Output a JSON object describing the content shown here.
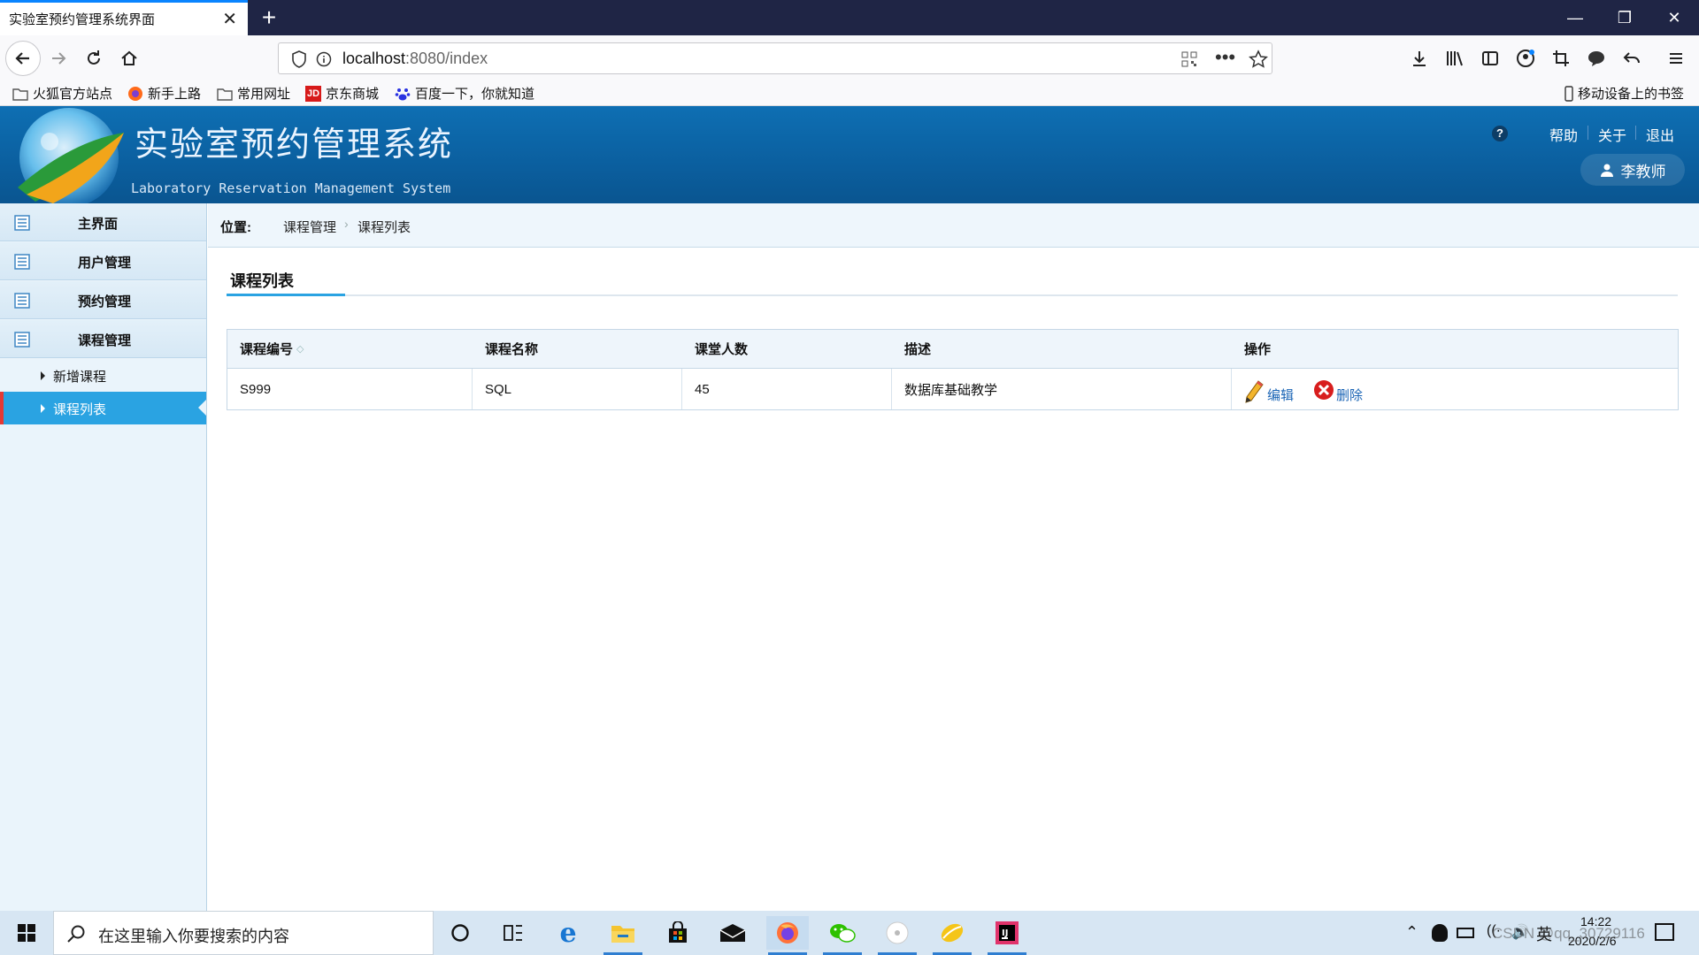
{
  "browser": {
    "tab_title": "实验室预约管理系统界面",
    "url_host": "localhost",
    "url_rest": ":8080/index",
    "bookmarks": [
      "火狐官方站点",
      "新手上路",
      "常用网址",
      "京东商城",
      "百度一下，你就知道"
    ],
    "mobile_bookmarks": "移动设备上的书签"
  },
  "header": {
    "title": "实验室预约管理系统",
    "subtitle": "Laboratory Reservation Management System",
    "help": "帮助",
    "about": "关于",
    "logout": "退出",
    "user": "李教师"
  },
  "sidebar": {
    "items": [
      {
        "label": "主界面"
      },
      {
        "label": "用户管理"
      },
      {
        "label": "预约管理"
      },
      {
        "label": "课程管理"
      }
    ],
    "subitems": [
      {
        "label": "新增课程"
      },
      {
        "label": "课程列表"
      }
    ]
  },
  "location": {
    "label": "位置:",
    "crumbs": [
      "课程管理",
      "课程列表"
    ]
  },
  "section_title": "课程列表",
  "table": {
    "headers": [
      "课程编号",
      "课程名称",
      "课堂人数",
      "描述",
      "操作"
    ],
    "rows": [
      {
        "id": "S999",
        "name": "SQL",
        "count": "45",
        "desc": "数据库基础教学",
        "edit": "编辑",
        "delete": "删除"
      }
    ]
  },
  "taskbar": {
    "search_placeholder": "在这里输入你要搜索的内容",
    "ime": "英",
    "time": "14:22",
    "date": "2020/2/6",
    "watermark": "CSDN @qq_30729116"
  },
  "colors": {
    "tab_bar": "#1f2545",
    "header_blue": "#0b5f9f",
    "active_menu": "#2aa3e2",
    "active_marker": "#e53935",
    "link": "#1a64b5"
  }
}
